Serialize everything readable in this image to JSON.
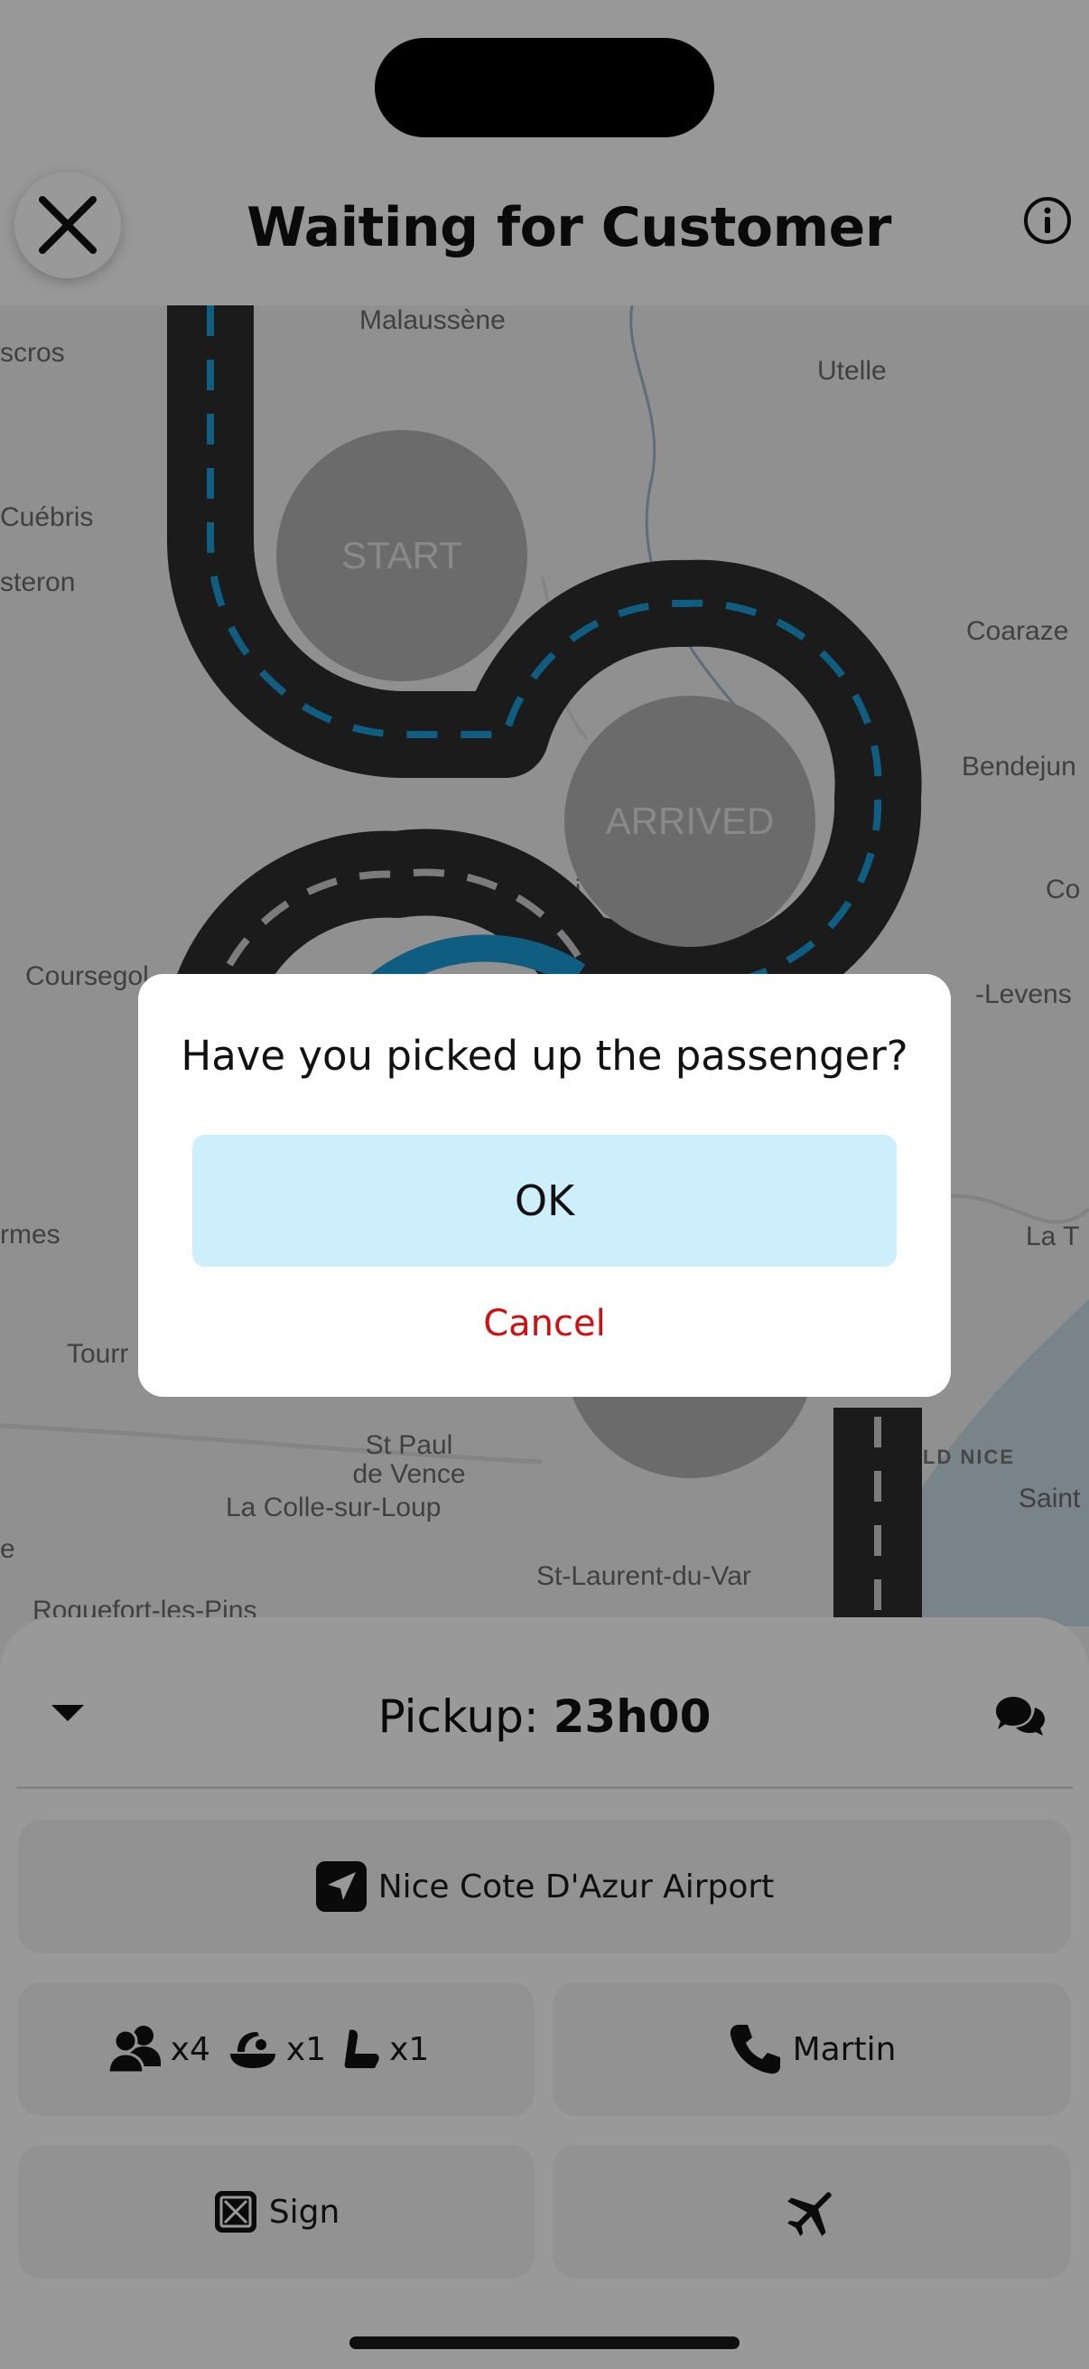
{
  "header": {
    "title": "Waiting for Customer",
    "close_icon": "close-icon",
    "info_icon": "info-icon"
  },
  "map": {
    "labels": [
      "Malaussène",
      "Utelle",
      "scros",
      "Cuébris",
      "steron",
      "Coaraze",
      "Bendejun",
      "Co",
      "Coursegol",
      "-Levens",
      "rmes",
      "La T",
      "Tourr",
      "St Paul de Vence",
      "La Colle-sur-Loup",
      "LD NICE",
      "Saint",
      "e",
      "Roquefort-les-Pins",
      "St-Laurent-du-Var",
      "Sai",
      "e"
    ],
    "steps": [
      "START",
      "ARRIVED"
    ]
  },
  "sheet": {
    "pickup_prefix": "Pickup: ",
    "pickup_time": "23h00",
    "destination": "Nice Cote D'Azur Airport",
    "passengers": "x4",
    "baby_seats": "x1",
    "booster_seats": "x1",
    "contact_name": "Martin",
    "sign_label": "Sign",
    "icons": [
      "chevron-down-icon",
      "chat-icon",
      "navigation-icon",
      "passengers-icon",
      "baby-seat-icon",
      "booster-seat-icon",
      "phone-icon",
      "sign-icon",
      "airplane-icon"
    ]
  },
  "dialog": {
    "message": "Have you picked up the passenger?",
    "ok_label": "OK",
    "cancel_label": "Cancel"
  },
  "colors": {
    "road": "#2e2e2e",
    "road_dash_blue": "#1a9bd7",
    "ok_button_bg": "#cdeefb",
    "cancel_text": "#d01010"
  }
}
